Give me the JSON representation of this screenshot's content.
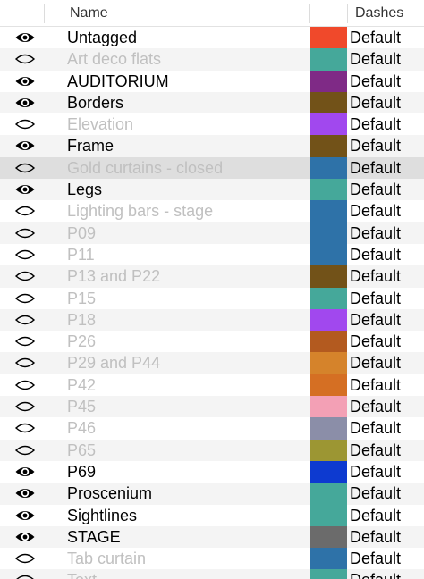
{
  "header": {
    "name_label": "Name",
    "dashes_label": "Dashes"
  },
  "rows": [
    {
      "visible": true,
      "name": "Untagged",
      "color": "#f0492b",
      "dashes": "Default"
    },
    {
      "visible": false,
      "name": "Art deco flats",
      "color": "#45a89a",
      "dashes": "Default"
    },
    {
      "visible": true,
      "name": "AUDITORIUM",
      "color": "#7f2a86",
      "dashes": "Default"
    },
    {
      "visible": true,
      "name": "Borders",
      "color": "#725218",
      "dashes": "Default"
    },
    {
      "visible": false,
      "name": "Elevation",
      "color": "#a148ee",
      "dashes": "Default"
    },
    {
      "visible": true,
      "name": "Frame",
      "color": "#725218",
      "dashes": "Default"
    },
    {
      "visible": false,
      "name": "Gold curtains - closed",
      "color": "#2e72a8",
      "dashes": "Default",
      "selected": true
    },
    {
      "visible": true,
      "name": "Legs",
      "color": "#45a89a",
      "dashes": "Default"
    },
    {
      "visible": false,
      "name": "Lighting bars - stage",
      "color": "#2e72a8",
      "dashes": "Default"
    },
    {
      "visible": false,
      "name": "P09",
      "color": "#2e72a8",
      "dashes": "Default"
    },
    {
      "visible": false,
      "name": "P11",
      "color": "#2e72a8",
      "dashes": "Default"
    },
    {
      "visible": false,
      "name": "P13 and P22",
      "color": "#725218",
      "dashes": "Default"
    },
    {
      "visible": false,
      "name": "P15",
      "color": "#45a89a",
      "dashes": "Default"
    },
    {
      "visible": false,
      "name": "P18",
      "color": "#a148ee",
      "dashes": "Default"
    },
    {
      "visible": false,
      "name": "P26",
      "color": "#b35a1f",
      "dashes": "Default"
    },
    {
      "visible": false,
      "name": "P29 and P44",
      "color": "#d5832b",
      "dashes": "Default"
    },
    {
      "visible": false,
      "name": "P42",
      "color": "#d56f23",
      "dashes": "Default"
    },
    {
      "visible": false,
      "name": "P45",
      "color": "#f3a0b5",
      "dashes": "Default"
    },
    {
      "visible": false,
      "name": "P46",
      "color": "#8b8ea8",
      "dashes": "Default"
    },
    {
      "visible": false,
      "name": "P65",
      "color": "#9c9633",
      "dashes": "Default"
    },
    {
      "visible": true,
      "name": "P69",
      "color": "#0d3ad0",
      "dashes": "Default"
    },
    {
      "visible": true,
      "name": "Proscenium",
      "color": "#45a89a",
      "dashes": "Default"
    },
    {
      "visible": true,
      "name": "Sightlines",
      "color": "#45a89a",
      "dashes": "Default"
    },
    {
      "visible": true,
      "name": "STAGE",
      "color": "#6b6b6b",
      "dashes": "Default"
    },
    {
      "visible": false,
      "name": "Tab curtain",
      "color": "#2e72a8",
      "dashes": "Default"
    },
    {
      "visible": false,
      "name": "Text",
      "color": "#45a89a",
      "dashes": "Default"
    }
  ]
}
